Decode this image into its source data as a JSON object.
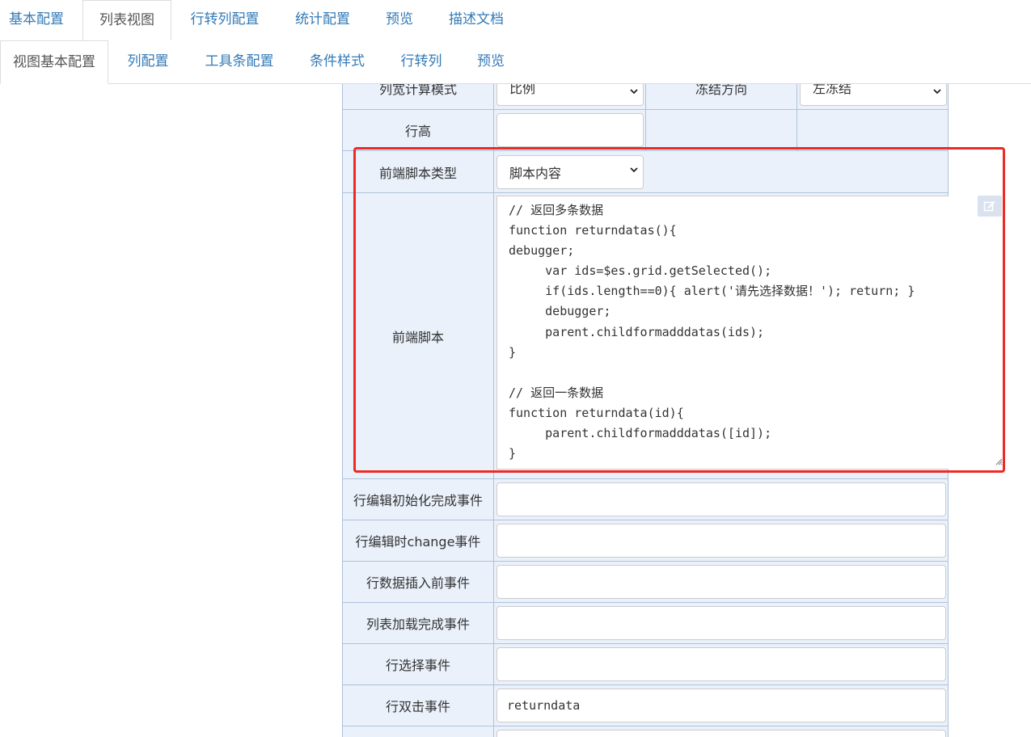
{
  "top_tabs": [
    "基本配置",
    "列表视图",
    "行转列配置",
    "统计配置",
    "预览",
    "描述文档"
  ],
  "sub_tabs": [
    "视图基本配置",
    "列配置",
    "工具条配置",
    "条件样式",
    "行转列",
    "预览"
  ],
  "form": {
    "width_mode_label": "列宽计算模式",
    "width_mode_value": "比例",
    "freeze_label": "冻结方向",
    "freeze_value": "左冻结",
    "row_height_label": "行高",
    "script_type_label": "前端脚本类型",
    "script_type_value": "脚本内容",
    "script_label": "前端脚本",
    "script_lines": [
      "// 返回多条数据",
      "function returndatas(){",
      "debugger;",
      "     var ids=$es.grid.getSelected();",
      "     if(ids.length==0){ alert('请先选择数据！'); return; }",
      "     debugger;",
      "     parent.childformadddatas(ids);",
      "}",
      "",
      "// 返回一条数据",
      "function returndata(id){",
      "     parent.childformadddatas([id]);",
      "}"
    ],
    "events": [
      {
        "label": "行编辑初始化完成事件",
        "value": ""
      },
      {
        "label": "行编辑时change事件",
        "value": ""
      },
      {
        "label": "行数据插入前事件",
        "value": ""
      },
      {
        "label": "列表加载完成事件",
        "value": ""
      },
      {
        "label": "行选择事件",
        "value": ""
      },
      {
        "label": "行双击事件",
        "value": "returndata"
      }
    ]
  },
  "colors": {
    "link": "#337ab7",
    "label_bg": "#eaf1fb",
    "cell_border": "#aec2db",
    "highlight": "#ee2a24"
  }
}
